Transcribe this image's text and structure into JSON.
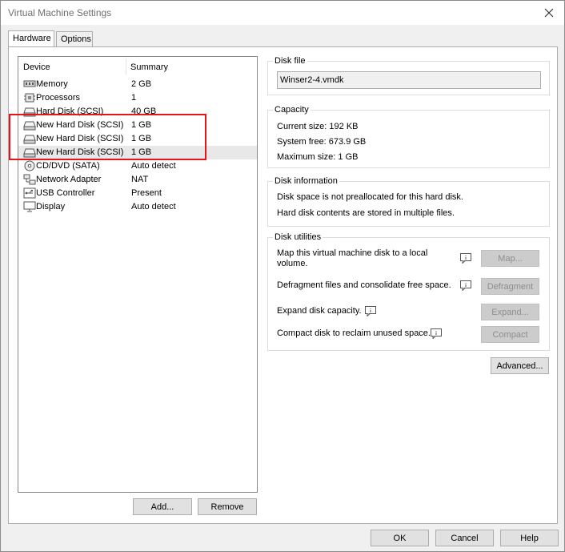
{
  "window": {
    "title": "Virtual Machine Settings"
  },
  "tabs": [
    {
      "label": "Hardware",
      "active": true
    },
    {
      "label": "Options",
      "active": false
    }
  ],
  "device_list": {
    "headers": {
      "device": "Device",
      "summary": "Summary"
    },
    "rows": [
      {
        "icon": "memory-icon",
        "device": "Memory",
        "summary": "2 GB"
      },
      {
        "icon": "processor-icon",
        "device": "Processors",
        "summary": "1"
      },
      {
        "icon": "hard-disk-icon",
        "device": "Hard Disk (SCSI)",
        "summary": "40 GB"
      },
      {
        "icon": "hard-disk-icon",
        "device": "New Hard Disk (SCSI)",
        "summary": "1 GB"
      },
      {
        "icon": "hard-disk-icon",
        "device": "New Hard Disk (SCSI)",
        "summary": "1 GB"
      },
      {
        "icon": "hard-disk-icon",
        "device": "New Hard Disk (SCSI)",
        "summary": "1 GB",
        "selected": true
      },
      {
        "icon": "cd-dvd-icon",
        "device": "CD/DVD (SATA)",
        "summary": "Auto detect"
      },
      {
        "icon": "network-adapter-icon",
        "device": "Network Adapter",
        "summary": "NAT"
      },
      {
        "icon": "usb-controller-icon",
        "device": "USB Controller",
        "summary": "Present"
      },
      {
        "icon": "display-icon",
        "device": "Display",
        "summary": "Auto detect"
      }
    ],
    "add_label": "Add...",
    "remove_label": "Remove"
  },
  "disk_file": {
    "title": "Disk file",
    "value": "Winser2-4.vmdk"
  },
  "capacity": {
    "title": "Capacity",
    "current_size": "Current size:  192 KB",
    "system_free": "System free:  673.9 GB",
    "maximum_size": "Maximum size:  1 GB"
  },
  "disk_information": {
    "title": "Disk information",
    "line1": "Disk space is not preallocated for this hard disk.",
    "line2": "Hard disk contents are stored in multiple files."
  },
  "disk_utilities": {
    "title": "Disk utilities",
    "map_text": "Map this virtual machine disk to a local volume.",
    "map_label": "Map...",
    "defrag_text": "Defragment files and consolidate free space.",
    "defrag_label": "Defragment",
    "expand_text": "Expand disk capacity.",
    "expand_label": "Expand...",
    "compact_text": "Compact disk to reclaim unused space.",
    "compact_label": "Compact"
  },
  "advanced_label": "Advanced...",
  "footer": {
    "ok_label": "OK",
    "cancel_label": "Cancel",
    "help_label": "Help"
  },
  "colors": {
    "highlight": "#e8141b",
    "selected_row": "#e8e8e8"
  }
}
